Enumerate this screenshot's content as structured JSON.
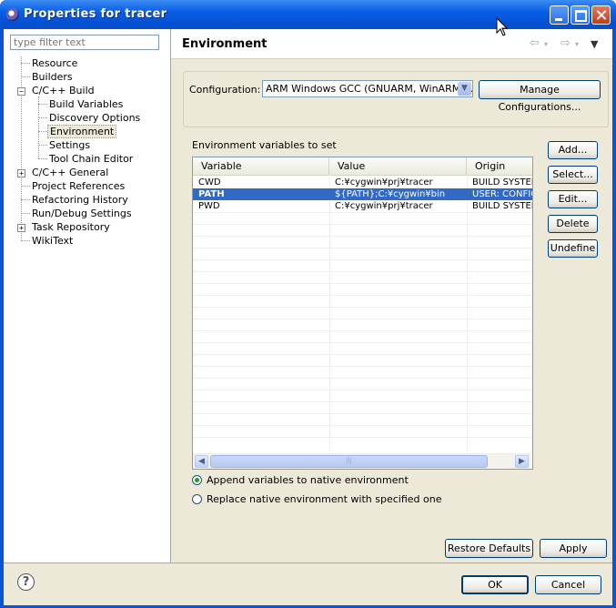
{
  "window": {
    "title": "Properties for tracer"
  },
  "filter": {
    "placeholder": "type filter text"
  },
  "tree": {
    "resource": "Resource",
    "builders": "Builders",
    "cpp_build": "C/C++ Build",
    "build_variables": "Build Variables",
    "discovery_options": "Discovery Options",
    "environment": "Environment",
    "settings": "Settings",
    "tool_chain_editor": "Tool Chain Editor",
    "cpp_general": "C/C++ General",
    "project_references": "Project References",
    "refactoring_history": "Refactoring History",
    "run_debug_settings": "Run/Debug Settings",
    "task_repository": "Task Repository",
    "wikitext": "WikiText"
  },
  "page": {
    "title": "Environment",
    "configuration_label": "Configuration:",
    "configuration_value": "ARM Windows GCC (GNUARM, WinARM, ...",
    "manage_configurations": "Manage Configurations...",
    "env_label": "Environment variables to set",
    "columns": {
      "variable": "Variable",
      "value": "Value",
      "origin": "Origin"
    },
    "rows": [
      {
        "variable": "CWD",
        "value": "C:¥cygwin¥prj¥tracer",
        "origin": "BUILD SYSTEM"
      },
      {
        "variable": "PATH",
        "value": "${PATH};C:¥cygwin¥bin",
        "origin": "USER: CONFIG"
      },
      {
        "variable": "PWD",
        "value": "C:¥cygwin¥prj¥tracer",
        "origin": "BUILD SYSTEM"
      }
    ],
    "buttons": {
      "add": "Add...",
      "select": "Select...",
      "edit": "Edit...",
      "delete": "Delete",
      "undefine": "Undefine"
    },
    "radio_append": "Append variables to native environment",
    "radio_replace": "Replace native environment with specified one",
    "restore_defaults": "Restore Defaults",
    "apply": "Apply"
  },
  "dialog": {
    "ok": "OK",
    "cancel": "Cancel",
    "help": "?"
  }
}
